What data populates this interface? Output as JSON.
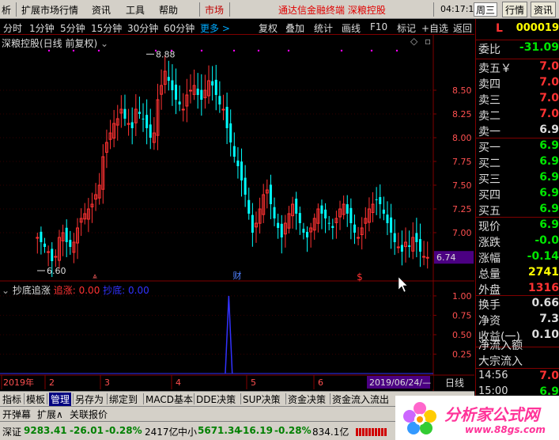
{
  "menu": {
    "items": [
      "析",
      "扩展市场行情",
      "资讯",
      "工具",
      "帮助"
    ],
    "market": "市场",
    "title": "通达信金融终端 深粮控股",
    "clock": "04:17:10",
    "weekday": "周三",
    "quote_btn": "行情",
    "info_btn": "资讯"
  },
  "chart": {
    "title": "深粮控股(日线 前复权)",
    "periods": [
      "分时",
      "1分钟",
      "5分钟",
      "15分钟",
      "30分钟",
      "60分钟",
      "更多 >"
    ],
    "tools": [
      "复权",
      "叠加",
      "统计",
      "画线",
      "F10",
      "标记",
      "+自选",
      "返回"
    ],
    "current_price_tag": "6.74",
    "high_label": "8.88",
    "low_label": "6.60",
    "cai_marker": "财",
    "dollar_marker": "$",
    "date_tag": "2019/06/24/—",
    "axis_label": "日线",
    "x_labels": [
      "2019年",
      "2",
      "3",
      "4",
      "5",
      "6"
    ],
    "indicator": {
      "name": "抄底追涨",
      "s1_label": "追涨",
      "s1_value": "0.00",
      "s2_label": "抄底",
      "s2_value": "0.00"
    }
  },
  "chart_data": [
    {
      "type": "candlestick",
      "title": "",
      "ylim": [
        6.5,
        9.0
      ],
      "yticks": [
        7.0,
        7.25,
        7.5,
        7.75,
        8.0,
        8.25,
        8.5
      ],
      "high": 8.88,
      "low": 6.6,
      "last": 6.74,
      "x_ticks": [
        "2019年",
        "2",
        "3",
        "4",
        "5",
        "6"
      ],
      "closes": [
        6.95,
        6.9,
        6.85,
        6.8,
        6.7,
        6.75,
        6.95,
        7.0,
        6.9,
        6.85,
        6.9,
        7.05,
        7.15,
        7.2,
        7.25,
        7.3,
        7.4,
        7.5,
        7.8,
        7.95,
        8.05,
        8.15,
        8.2,
        8.3,
        8.2,
        8.15,
        8.1,
        8.3,
        8.25,
        8.2,
        8.1,
        8.0,
        8.05,
        8.4,
        8.55,
        8.7,
        8.6,
        8.5,
        8.4,
        8.35,
        8.3,
        8.45,
        8.5,
        8.55,
        8.45,
        8.4,
        8.5,
        8.6,
        8.55,
        8.45,
        8.35,
        8.3,
        8.1,
        7.95,
        7.8,
        7.7,
        7.55,
        7.4,
        7.2,
        7.0,
        7.1,
        7.25,
        7.4,
        7.45,
        7.3,
        7.15,
        7.05,
        6.95,
        7.1,
        7.2,
        7.3,
        7.2,
        7.1,
        7.0,
        6.95,
        7.05,
        7.15,
        7.25,
        7.2,
        7.15,
        7.1,
        7.05,
        7.15,
        7.25,
        7.3,
        7.2,
        7.1,
        7.0,
        6.95,
        7.05,
        7.15,
        7.25,
        7.3,
        7.35,
        7.3,
        7.2,
        7.1,
        7.0,
        6.9,
        6.85,
        6.8,
        6.9,
        6.85,
        6.95,
        6.9,
        6.8,
        6.75,
        6.74
      ]
    },
    {
      "type": "line",
      "title": "",
      "ylim": [
        0,
        1.05
      ],
      "yticks": [
        0.25,
        0.5,
        0.75,
        1.0
      ],
      "series": [
        {
          "name": "追涨",
          "color": "#ff3232",
          "values": []
        },
        {
          "name": "抄底",
          "color": "#3232ff",
          "values": [
            [
              0.52,
              0
            ],
            [
              0.528,
              1.0
            ],
            [
              0.536,
              0
            ]
          ]
        }
      ]
    }
  ],
  "quote": {
    "code_label": "L",
    "code": "000019",
    "weibi_label": "委比",
    "weibi": "-31.09",
    "sell": [
      {
        "label": "卖五￥",
        "price": "7.0"
      },
      {
        "label": "卖四",
        "price": "7.0"
      },
      {
        "label": "卖三",
        "price": "7.0"
      },
      {
        "label": "卖二",
        "price": "7.0"
      },
      {
        "label": "卖一",
        "price": "6.9"
      }
    ],
    "buy": [
      {
        "label": "买一",
        "price": "6.9"
      },
      {
        "label": "买二",
        "price": "6.9"
      },
      {
        "label": "买三",
        "price": "6.9"
      },
      {
        "label": "买四",
        "price": "6.9"
      },
      {
        "label": "买五",
        "price": "6.9"
      }
    ],
    "stats": [
      {
        "label": "现价",
        "value": "6.9",
        "cls": "green"
      },
      {
        "label": "涨跌",
        "value": "-0.0",
        "cls": "green"
      },
      {
        "label": "涨幅",
        "value": "-0.14",
        "cls": "green"
      },
      {
        "label": "总量",
        "value": "2741",
        "cls": "yellow"
      },
      {
        "label": "外盘",
        "value": "1316",
        "cls": "red"
      }
    ],
    "stats2": [
      {
        "label": "换手",
        "value": "0.66",
        "cls": "white"
      },
      {
        "label": "净资",
        "value": "7.3",
        "cls": "white"
      },
      {
        "label": "收益(一)",
        "value": "0.10",
        "cls": "white"
      }
    ],
    "flows": [
      "净流入额",
      "大宗流入"
    ],
    "ticks": [
      {
        "time": "14:56",
        "price": "7.0",
        "cls": "red"
      },
      {
        "time": "15:00",
        "price": "6.9",
        "cls": "green"
      }
    ]
  },
  "tabs1": [
    "指标",
    "模板",
    "管理",
    "另存为",
    "绑定到",
    "MACD基本",
    "DDE决策",
    "SUP决策",
    "资金决策",
    "资金流入流出"
  ],
  "tabs2": [
    "开弹幕",
    "扩展∧",
    "关联报价"
  ],
  "status": {
    "sz_label": "深证",
    "sz_value": "9283.41",
    "sz_change": "-26.01",
    "sz_pct": "-0.28%",
    "sz_amount": "2417亿",
    "zx_label": "中小",
    "zx_value": "5671.34",
    "zx_change": "-16.19",
    "zx_pct": "-0.28%",
    "zx_amount": "834.1亿"
  },
  "logo": {
    "text": "分析家公式网",
    "url": "www.88gs.com"
  },
  "colors": {
    "up": "#ff3232",
    "down": "#00ffff",
    "grid": "#800000",
    "accent": "#ff00ff"
  }
}
